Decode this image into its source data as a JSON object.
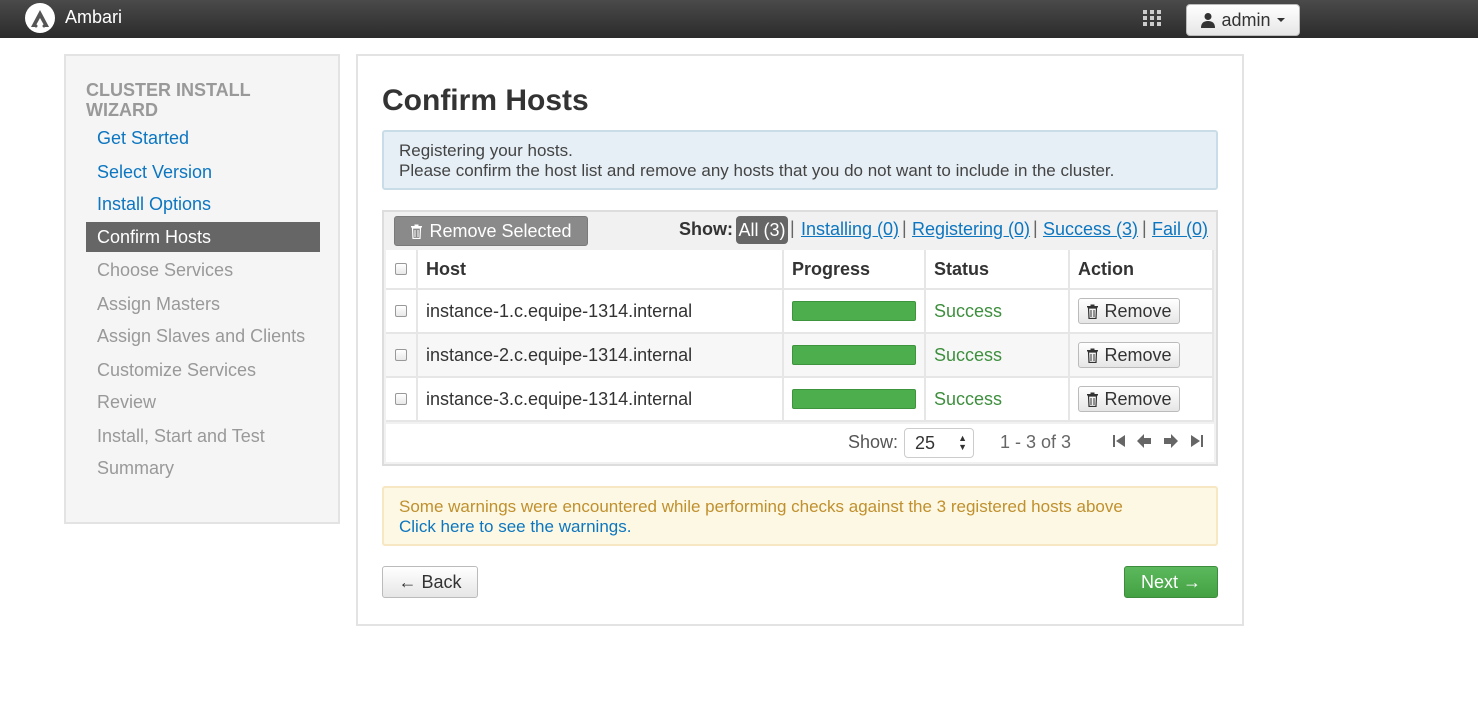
{
  "app": {
    "brand": "Ambari"
  },
  "header": {
    "user_label": "admin"
  },
  "sidebar": {
    "title": "CLUSTER INSTALL WIZARD",
    "items": [
      {
        "label": "Get Started",
        "state": "link"
      },
      {
        "label": "Select Version",
        "state": "link"
      },
      {
        "label": "Install Options",
        "state": "link"
      },
      {
        "label": "Confirm Hosts",
        "state": "active"
      },
      {
        "label": "Choose Services",
        "state": "disabled"
      },
      {
        "label": "Assign Masters",
        "state": "disabled"
      },
      {
        "label": "Assign Slaves and Clients",
        "state": "disabled"
      },
      {
        "label": "Customize Services",
        "state": "disabled"
      },
      {
        "label": "Review",
        "state": "disabled"
      },
      {
        "label": "Install, Start and Test",
        "state": "disabled"
      },
      {
        "label": "Summary",
        "state": "disabled"
      }
    ]
  },
  "main": {
    "title": "Confirm Hosts",
    "info": {
      "line1": "Registering your hosts.",
      "line2": "Please confirm the host list and remove any hosts that you do not want to include in the cluster."
    },
    "toolbar": {
      "remove_selected": "Remove Selected",
      "show_label": "Show:",
      "filters": [
        {
          "label": "All (3)",
          "active": true
        },
        {
          "label": "Installing (0)",
          "active": false
        },
        {
          "label": "Registering (0)",
          "active": false
        },
        {
          "label": "Success (3)",
          "active": false
        },
        {
          "label": "Fail (0)",
          "active": false
        }
      ]
    },
    "table": {
      "headers": [
        "Host",
        "Progress",
        "Status",
        "Action"
      ],
      "rows": [
        {
          "host": "instance-1.c.equipe-1314.internal",
          "progress": 1.0,
          "status": "Success",
          "action": "Remove"
        },
        {
          "host": "instance-2.c.equipe-1314.internal",
          "progress": 1.0,
          "status": "Success",
          "action": "Remove"
        },
        {
          "host": "instance-3.c.equipe-1314.internal",
          "progress": 1.0,
          "status": "Success",
          "action": "Remove"
        }
      ]
    },
    "pager": {
      "show_label": "Show:",
      "page_size": "25",
      "range": "1 - 3 of 3"
    },
    "warning": {
      "text": "Some warnings were encountered while performing checks against the 3 registered hosts above",
      "link": "Click here to see the warnings."
    },
    "buttons": {
      "back": "← Back",
      "next": "Next →"
    }
  },
  "colors": {
    "accent_link": "#0c76c0",
    "success": "#3e8f3e",
    "progress": "#4cae4c",
    "next_button": "#5cb85c",
    "warning_text": "#c0902e"
  }
}
